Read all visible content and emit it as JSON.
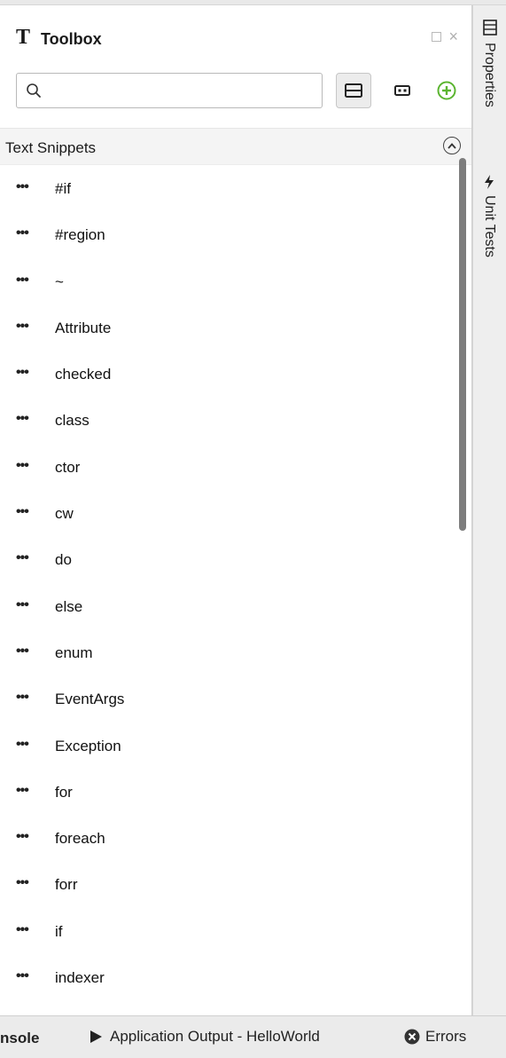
{
  "panel": {
    "title": "Toolbox",
    "logo_glyph": "T"
  },
  "search": {
    "value": "",
    "placeholder": ""
  },
  "category": {
    "label": "Text Snippets"
  },
  "items": [
    "#if",
    "#region",
    "~",
    "Attribute",
    "checked",
    "class",
    "ctor",
    "cw",
    "do",
    "else",
    "enum",
    "EventArgs",
    "Exception",
    "for",
    "foreach",
    "forr",
    "if",
    "indexer"
  ],
  "item_dots": "•••",
  "side_tabs": {
    "properties": "Properties",
    "unit_tests": "Unit Tests"
  },
  "bottom_bar": {
    "console": "nsole",
    "application_output": "Application Output - HelloWorld",
    "errors": "Errors"
  },
  "colors": {
    "accent_green": "#5cb531",
    "scrollbar": "#7d7d7d"
  }
}
